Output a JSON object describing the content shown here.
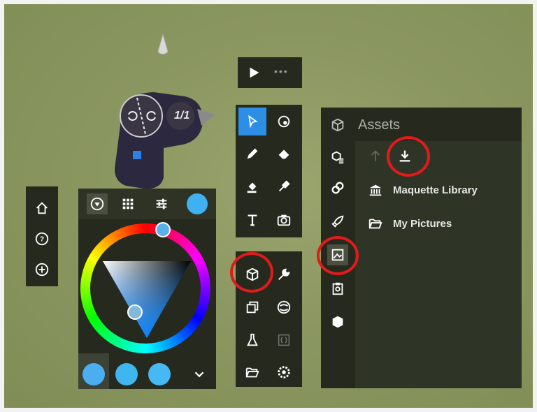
{
  "play_bar": {
    "more_label": "•••"
  },
  "controller": {
    "page_indicator": "1/1"
  },
  "assets_panel": {
    "title": "Assets",
    "items": [
      {
        "label": "Maquette Library",
        "icon": "library-icon"
      },
      {
        "label": "My Pictures",
        "icon": "folder-icon"
      }
    ]
  },
  "color_picker": {
    "current_color": "#3fb0f0",
    "recent_colors": [
      "#4aaef0",
      "#3fb6f0",
      "#46b8f3"
    ]
  },
  "colors": {
    "annotation_ring": "#e11b1b",
    "accent": "#2d8ee6"
  }
}
